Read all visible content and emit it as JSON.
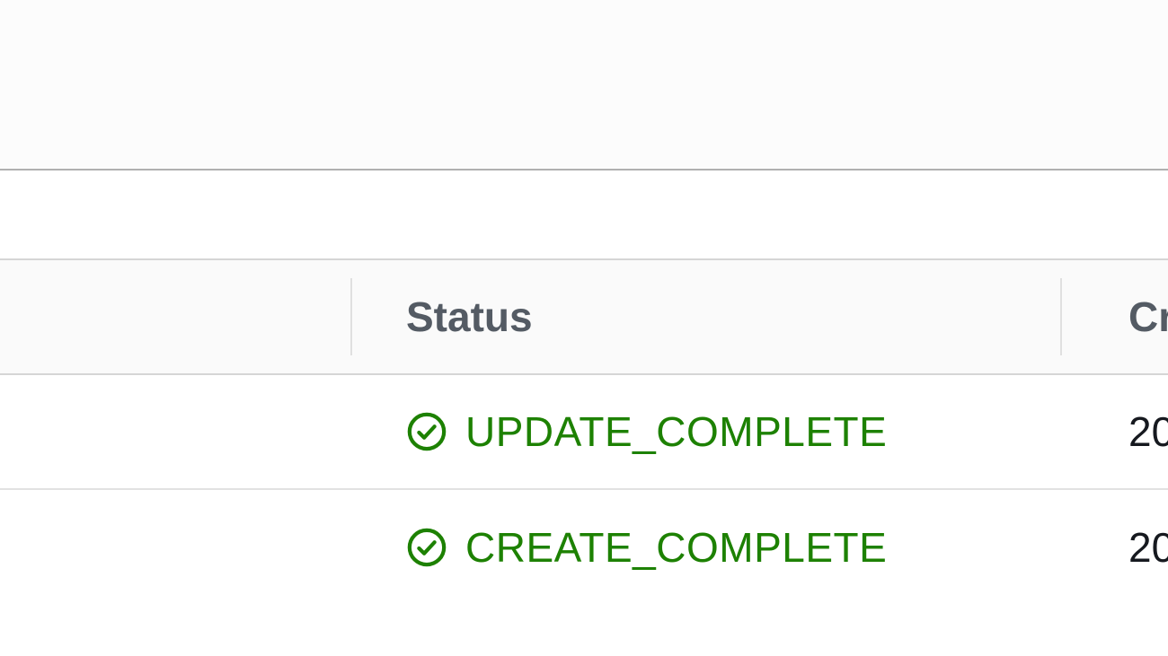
{
  "table": {
    "columns": {
      "status": "Status",
      "created_partial": "Cr"
    },
    "rows": [
      {
        "status_text": "UPDATE_COMPLETE",
        "status_icon": "check-circle-icon",
        "status_color": "#1d8102",
        "created_partial": "20"
      },
      {
        "status_text": "CREATE_COMPLETE",
        "status_icon": "check-circle-icon",
        "status_color": "#1d8102",
        "created_partial": "20"
      }
    ]
  }
}
